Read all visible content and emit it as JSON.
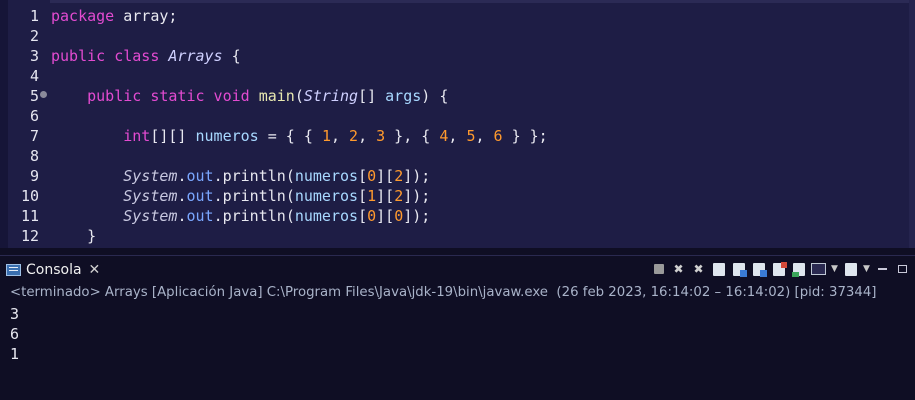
{
  "editor": {
    "lines": [
      {
        "n": "1"
      },
      {
        "n": "2"
      },
      {
        "n": "3"
      },
      {
        "n": "4"
      },
      {
        "n": "5"
      },
      {
        "n": "6"
      },
      {
        "n": "7"
      },
      {
        "n": "8"
      },
      {
        "n": "9"
      },
      {
        "n": "10"
      },
      {
        "n": "11"
      },
      {
        "n": "12"
      }
    ],
    "tokens": {
      "l1_kw": "package",
      "l1_rest": " array;",
      "l3_kw": "public class",
      "l3_cls": "Arrays",
      "l3_rest": " {",
      "l5_kw": "public static void",
      "l5_mth": "main",
      "l5_p1": "(",
      "l5_cls": "String",
      "l5_p2": "[] ",
      "l5_var": "args",
      "l5_p3": ") {",
      "l7_kw": "int",
      "l7_p1": "[][] ",
      "l7_var": "numeros",
      "l7_p2": " = { { ",
      "l7_n1": "1",
      "l7_c1": ", ",
      "l7_n2": "2",
      "l7_c2": ", ",
      "l7_n3": "3",
      "l7_p3": " }, { ",
      "l7_n4": "4",
      "l7_c3": ", ",
      "l7_n5": "5",
      "l7_c4": ", ",
      "l7_n6": "6",
      "l7_p4": " } };",
      "sys": "System",
      "dot": ".",
      "out": "out",
      "println": "println",
      "paren_open": "(",
      "var": "numeros",
      "l9_i1": "0",
      "l9_i2": "2",
      "l10_i1": "1",
      "l10_i2": "2",
      "l11_i1": "0",
      "l11_i2": "0",
      "br_open": "[",
      "br_mid": "][",
      "br_close": "]",
      "end": ");",
      "l12": "}"
    }
  },
  "console": {
    "tab_label": "Consola",
    "tab_close": "✕",
    "status": "<terminado> Arrays [Aplicación Java] C:\\Program Files\\Java\\jdk-19\\bin\\javaw.exe  (26 feb 2023, 16:14:02 – 16:14:02) [pid: 37344]",
    "output": [
      "3",
      "6",
      "1"
    ]
  },
  "toolbar_icons": [
    "terminate-icon",
    "remove-launch-icon",
    "remove-all-terminated-icon",
    "scroll-lock-icon",
    "word-wrap-icon",
    "show-on-stdout-icon",
    "show-on-stderr-icon",
    "pin-console-icon",
    "display-console-icon",
    "open-console-icon",
    "minimize-icon",
    "maximize-icon"
  ]
}
